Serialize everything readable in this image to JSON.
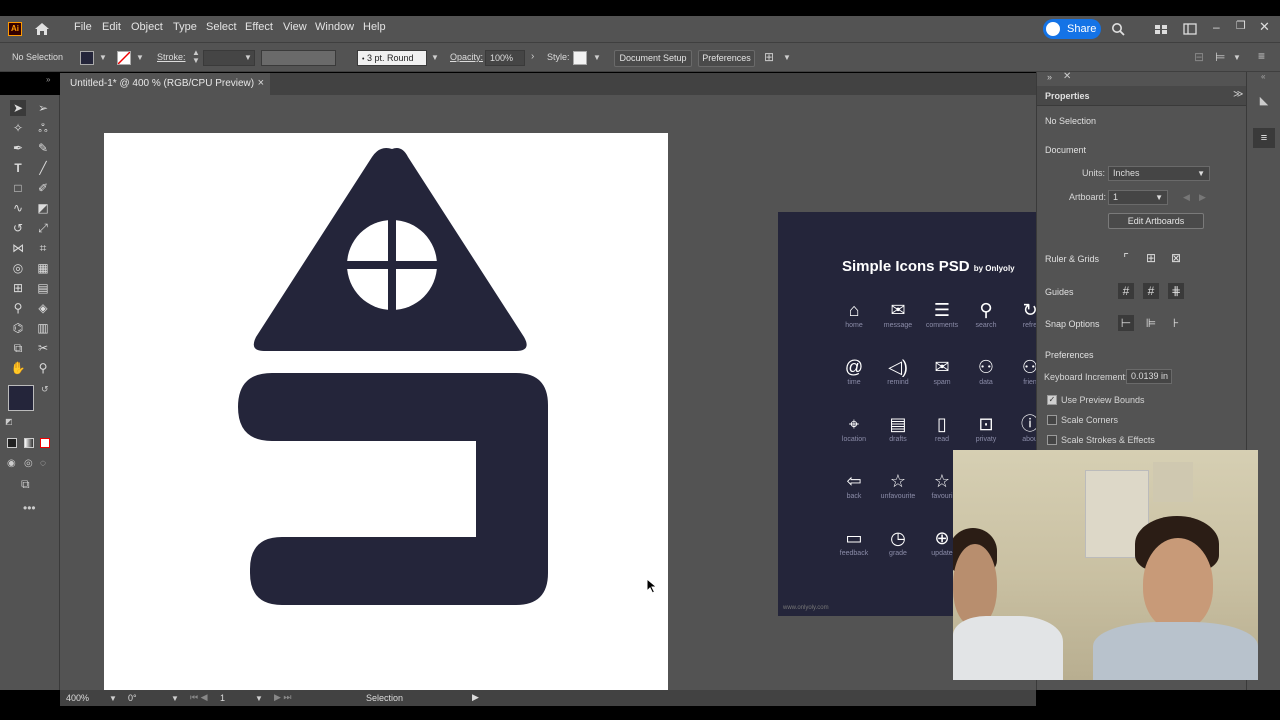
{
  "menubar": {
    "logo": "Ai",
    "items": [
      "File",
      "Edit",
      "Object",
      "Type",
      "Select",
      "Effect",
      "View",
      "Window",
      "Help"
    ],
    "share_label": "Share"
  },
  "controlbar": {
    "selection": "No Selection",
    "stroke_label": "Stroke:",
    "brush": "3 pt. Round",
    "opacity_label": "Opacity:",
    "opacity_value": "100%",
    "style_label": "Style:",
    "document_setup": "Document Setup",
    "preferences": "Preferences"
  },
  "tab": {
    "title": "Untitled-1* @ 400 % (RGB/CPU Preview)",
    "close": "×"
  },
  "statusbar": {
    "zoom": "400%",
    "rotation": "0°",
    "artboard_num": "1",
    "tool": "Selection"
  },
  "properties": {
    "title": "Properties",
    "selection": "No Selection",
    "document_heading": "Document",
    "units_label": "Units:",
    "units_value": "Inches",
    "artboard_label": "Artboard:",
    "artboard_value": "1",
    "edit_artboards": "Edit Artboards",
    "ruler_grids": "Ruler & Grids",
    "guides": "Guides",
    "snap_options": "Snap Options",
    "preferences_heading": "Preferences",
    "keyboard_increment_label": "Keyboard Increment:",
    "keyboard_increment_value": "0.0139 in",
    "use_preview_bounds": "Use Preview Bounds",
    "scale_corners": "Scale Corners",
    "scale_strokes": "Scale Strokes & Effects",
    "use_preview_bounds_checked": true,
    "scale_corners_checked": false,
    "scale_strokes_checked": false
  },
  "reference": {
    "title": "Simple Icons PSD",
    "by": "by Onlyoly",
    "url": "www.onlyoly.com",
    "icons": [
      [
        {
          "g": "⌂",
          "l": "home"
        },
        {
          "g": "✉",
          "l": "message"
        },
        {
          "g": "☰",
          "l": "comments"
        },
        {
          "g": "⚲",
          "l": "search"
        },
        {
          "g": "↻",
          "l": "refre"
        }
      ],
      [
        {
          "g": "@",
          "l": "time"
        },
        {
          "g": "◁)",
          "l": "remind"
        },
        {
          "g": "✉",
          "l": "spam"
        },
        {
          "g": "⚇",
          "l": "data"
        },
        {
          "g": "⚇",
          "l": "frien"
        }
      ],
      [
        {
          "g": "⌖",
          "l": "location"
        },
        {
          "g": "▤",
          "l": "drafts"
        },
        {
          "g": "▯",
          "l": "read"
        },
        {
          "g": "⊡",
          "l": "privaty"
        },
        {
          "g": "ⓘ",
          "l": "abou"
        }
      ],
      [
        {
          "g": "⇦",
          "l": "back"
        },
        {
          "g": "☆",
          "l": "unfavourite"
        },
        {
          "g": "☆",
          "l": "favouri"
        }
      ],
      [
        {
          "g": "▭",
          "l": "feedback"
        },
        {
          "g": "◷",
          "l": "grade"
        },
        {
          "g": "⊕",
          "l": "update"
        }
      ]
    ]
  },
  "colors": {
    "artwork_fill": "#24253a",
    "ui_bg": "#535353",
    "accent": "#1473e6"
  }
}
